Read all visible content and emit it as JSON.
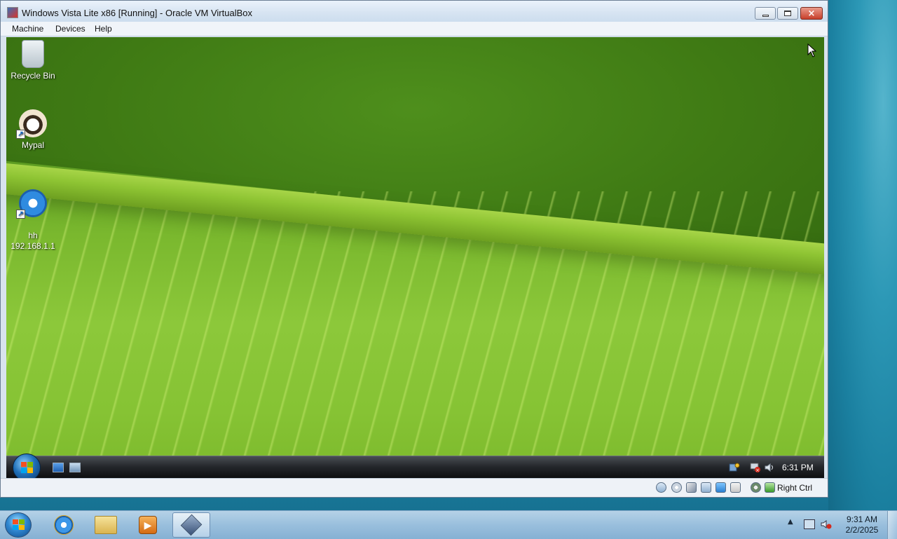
{
  "window": {
    "title": "Windows Vista Lite x86 [Running] - Oracle VM VirtualBox",
    "icon": "virtualbox-app-icon",
    "controls": {
      "minimize": "minimize-icon",
      "maximize": "maximize-icon",
      "close": "×"
    }
  },
  "menubar": {
    "items": [
      "Machine",
      "Devices",
      "Help"
    ]
  },
  "guest": {
    "desktop_icons": [
      {
        "label": "Recycle Bin",
        "icon": "recycle-bin-icon",
        "shortcut": false
      },
      {
        "label": "Mypal",
        "icon": "mypal-raccoon-icon",
        "shortcut": true
      },
      {
        "label": "hh\n192.168.1.1",
        "icon": "internet-explorer-icon",
        "shortcut": true
      }
    ],
    "taskbar": {
      "quick_launch": [
        "show-desktop-icon",
        "switch-windows-icon"
      ],
      "tray_icons": [
        "windows-update-icon",
        "network-disconnected-icon",
        "volume-icon"
      ],
      "clock": "6:31 PM"
    }
  },
  "statusbar": {
    "icons": [
      "hard-disk-icon",
      "optical-drive-icon",
      "audio-icon",
      "network-icon",
      "shared-folder-icon",
      "display-icon",
      "recording-icon",
      "mouse-integration-icon"
    ],
    "host_key": "Right Ctrl"
  },
  "host_taskbar": {
    "pinned": [
      "internet-explorer-icon",
      "file-explorer-icon",
      "media-player-icon",
      "virtualbox-icon"
    ],
    "active_index": 3,
    "time": "9:31 AM",
    "date": "2/2/2025"
  },
  "colors": {
    "wallpaper_green": "#7ab82e",
    "host_desktop": "#2a93b3",
    "vista_taskbar": "#25282c"
  }
}
